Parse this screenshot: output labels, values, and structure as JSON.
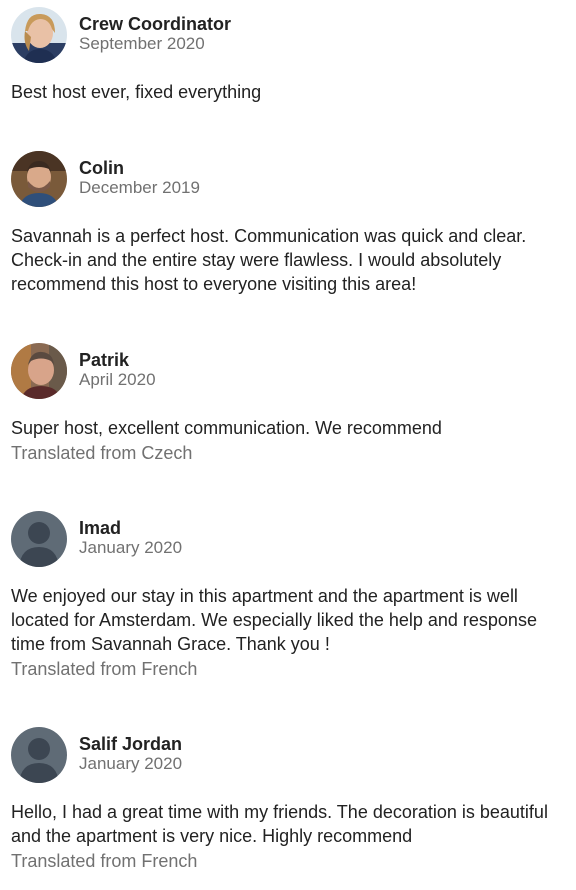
{
  "reviews": [
    {
      "name": "Crew Coordinator",
      "date": "September 2020",
      "text": "Best host ever, fixed everything",
      "translated": null,
      "avatar_icon": "user-photo-icon"
    },
    {
      "name": "Colin",
      "date": "December 2019",
      "text": "Savannah is a perfect host. Communication was quick and clear. Check-in and the entire stay were flawless. I would absolutely recommend this host to everyone visiting this area!",
      "translated": null,
      "avatar_icon": "user-photo-icon"
    },
    {
      "name": "Patrik",
      "date": "April 2020",
      "text": "Super host, excellent communication. We recommend",
      "translated": "Translated from Czech",
      "avatar_icon": "user-photo-icon"
    },
    {
      "name": "Imad",
      "date": "January 2020",
      "text": "We enjoyed our stay in this apartment and the apartment is well located for Amsterdam. We especially liked the help and response time from Savannah Grace. Thank you !",
      "translated": "Translated from French",
      "avatar_icon": "default-user-icon"
    },
    {
      "name": "Salif Jordan",
      "date": "January 2020",
      "text": "Hello, I had a great time with my friends. The decoration is beautiful and the apartment is very nice. Highly recommend",
      "translated": "Translated from French",
      "avatar_icon": "default-user-icon"
    }
  ],
  "colors": {
    "primary_text": "#222222",
    "secondary_text": "#717171",
    "default_avatar_bg": "#5f6b76",
    "default_avatar_fg": "#3c4652"
  }
}
